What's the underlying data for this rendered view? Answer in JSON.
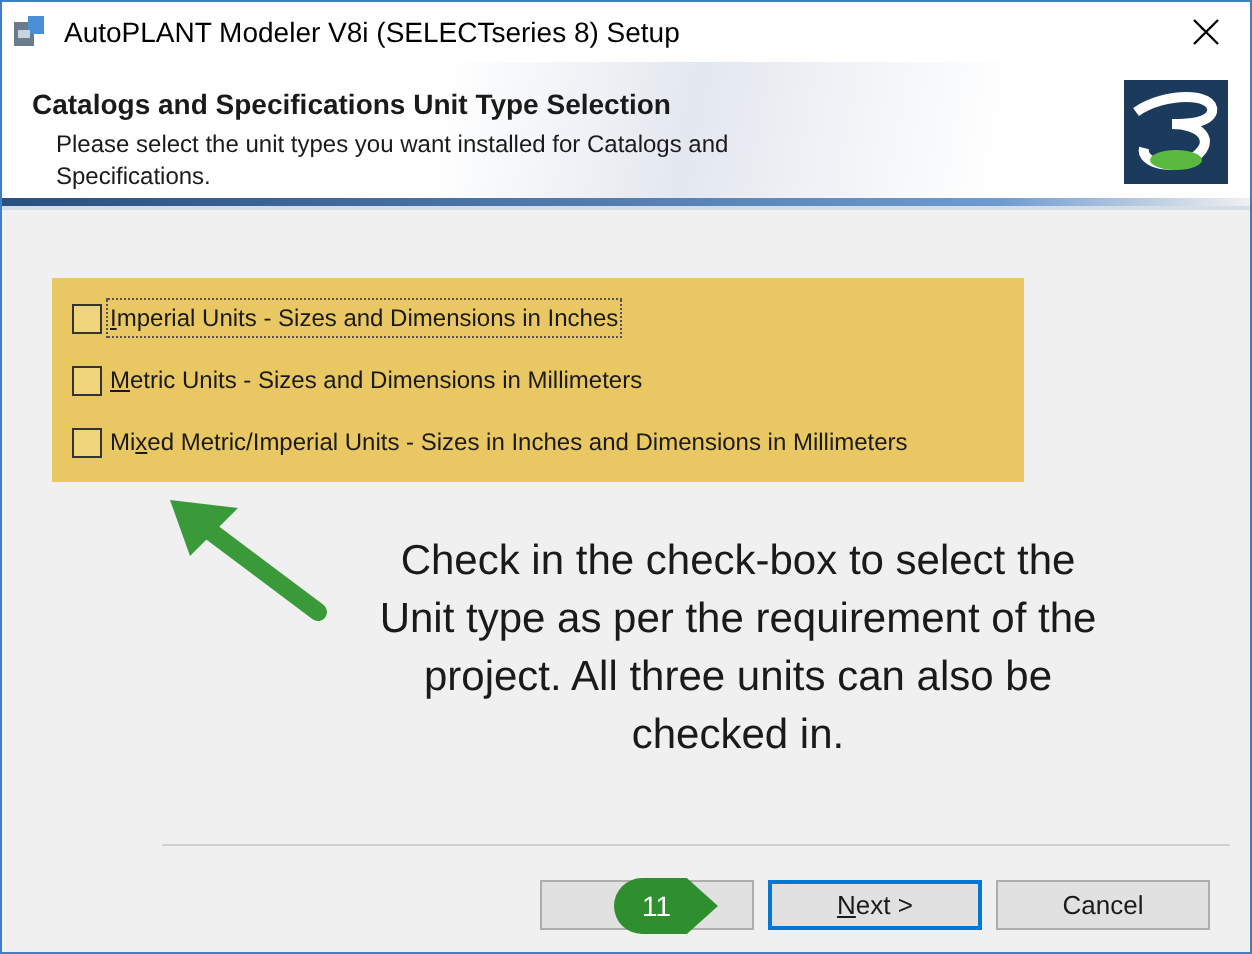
{
  "window": {
    "title": "AutoPLANT Modeler V8i (SELECTseries 8) Setup"
  },
  "header": {
    "title": "Catalogs and Specifications Unit Type Selection",
    "subtitle": "Please select the unit types you want installed for Catalogs and Specifications."
  },
  "options": [
    {
      "access_key": "I",
      "label_after": "mperial Units - Sizes and Dimensions in Inches",
      "checked": false,
      "focused": true
    },
    {
      "access_key": "M",
      "label_after": "etric Units - Sizes and Dimensions in Millimeters",
      "checked": false,
      "focused": false
    },
    {
      "label_before": "Mi",
      "access_key": "x",
      "label_after": "ed Metric/Imperial Units - Sizes in Inches and Dimensions in Millimeters",
      "checked": false,
      "focused": false
    }
  ],
  "annotation": {
    "text": "Check in the check-box to select the Unit type as per the requirement of the project. All three units can also be checked in.",
    "step_badge": "11"
  },
  "buttons": [
    {
      "default": false
    },
    {
      "access_key": "N",
      "label_after": "ext >",
      "default": true
    },
    {
      "label_before": "Cancel",
      "default": false
    }
  ]
}
